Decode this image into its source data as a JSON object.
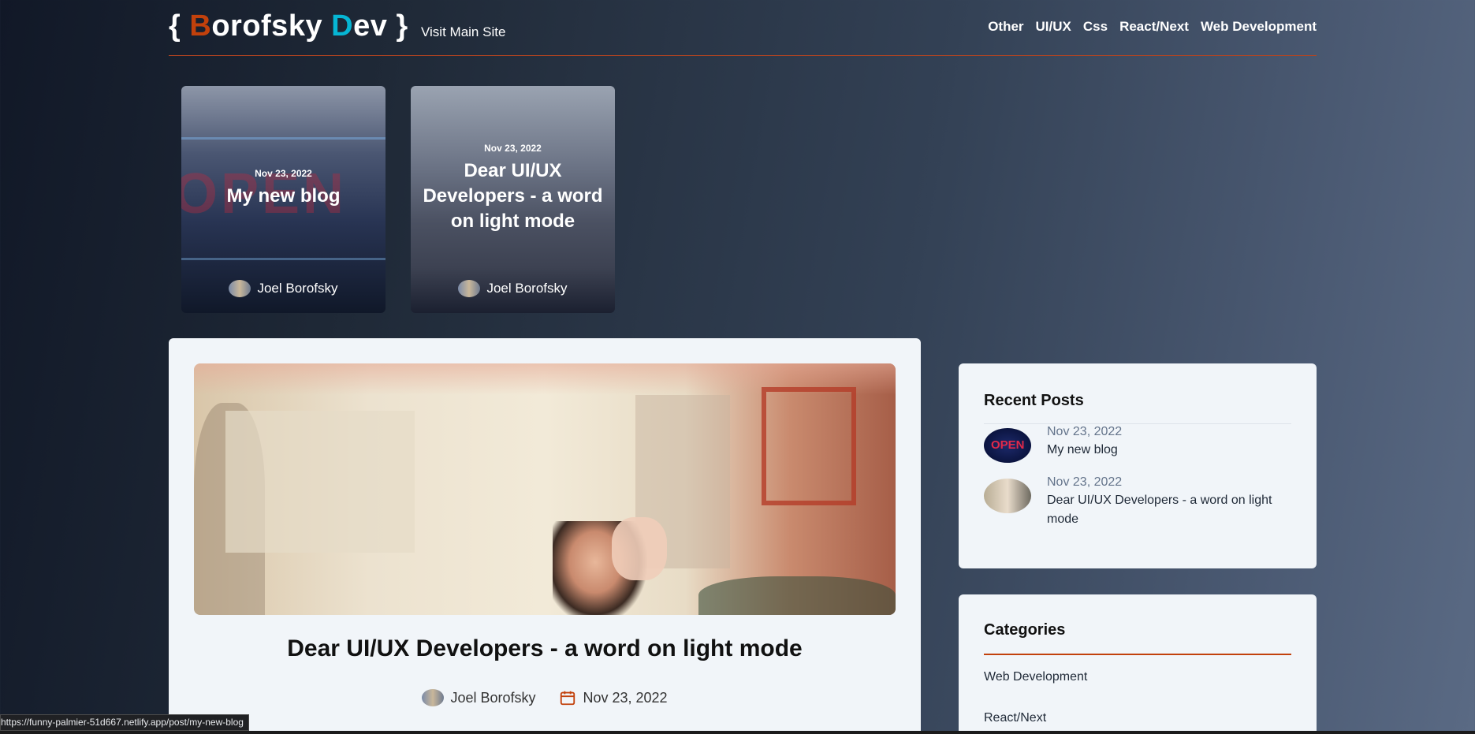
{
  "header": {
    "logo": {
      "open_brace": "{ ",
      "first_initial": "B",
      "first_rest": "orofsky ",
      "second_initial": "D",
      "second_rest": "ev",
      "close_brace": " }"
    },
    "visit_link": "Visit Main Site",
    "nav": [
      "Other",
      "UI/UX",
      "Css",
      "React/Next",
      "Web Development"
    ]
  },
  "featured": [
    {
      "date": "Nov 23, 2022",
      "title": "My new blog",
      "author": "Joel Borofsky"
    },
    {
      "date": "Nov 23, 2022",
      "title": "Dear UI/UX Developers - a word on light mode",
      "author": "Joel Borofsky"
    }
  ],
  "article": {
    "title": "Dear UI/UX Developers - a word on light mode",
    "author": "Joel Borofsky",
    "date": "Nov 23, 2022"
  },
  "recent_posts": {
    "heading": "Recent Posts",
    "items": [
      {
        "date": "Nov 23, 2022",
        "title": "My new blog"
      },
      {
        "date": "Nov 23, 2022",
        "title": "Dear UI/UX Developers - a word on light mode"
      }
    ]
  },
  "categories": {
    "heading": "Categories",
    "items": [
      "Web Development",
      "React/Next"
    ]
  },
  "status_bar": {
    "url": "https://funny-palmier-51d667.netlify.app/post/my-new-blog"
  },
  "colors": {
    "accent": "#c2410c",
    "logo_d": "#06b6d4",
    "panel": "#f1f5f9"
  }
}
